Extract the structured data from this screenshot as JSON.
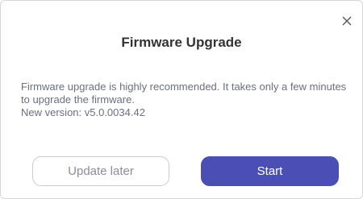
{
  "dialog": {
    "title": "Firmware Upgrade",
    "message_line1": "Firmware upgrade is highly recommended. It takes only a few minutes to upgrade the firmware.",
    "message_line2": "New version: v5.0.0034.42",
    "close_icon": "close-icon",
    "buttons": {
      "later_label": "Update later",
      "start_label": "Start"
    }
  },
  "colors": {
    "accent": "#4a4eb5",
    "title_text": "#333333",
    "body_text": "#6b6f82",
    "secondary_button_text": "#8a8d99",
    "secondary_button_border": "#c9cbd3"
  }
}
